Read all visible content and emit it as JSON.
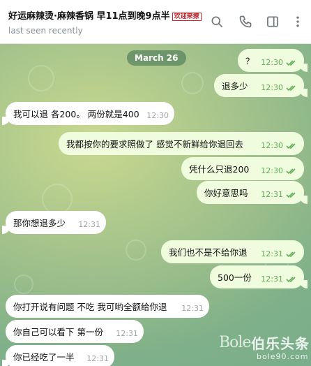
{
  "header": {
    "title": "好运麻辣烫·麻辣香锅 早11点到晚9点半",
    "title_badge": "欢迎来撩",
    "status": "last seen recently",
    "icons": [
      "search-icon",
      "phone-icon",
      "sidebar-toggle-icon",
      "more-vertical-icon"
    ]
  },
  "chat": {
    "date_label": "March 26",
    "messages": [
      {
        "dir": "out",
        "text": "？",
        "time": "12:30",
        "read": true
      },
      {
        "dir": "out",
        "text": "退多少",
        "time": "12:30",
        "read": true
      },
      {
        "dir": "in",
        "text": "我可以退 各200。 两份就是400",
        "time": "12:30"
      },
      {
        "dir": "out",
        "text": "我都按你的要求照做了 感觉不新鲜给你退回去",
        "time": "12:30",
        "read": true
      },
      {
        "dir": "out",
        "text": "凭什么只退200",
        "time": "12:30",
        "read": true
      },
      {
        "dir": "out",
        "text": "你好意思吗",
        "time": "12:31",
        "read": true
      },
      {
        "dir": "in",
        "text": "那你想退多少",
        "time": "12:31"
      },
      {
        "dir": "out",
        "text": "我们也不是不给你退",
        "time": "12:31",
        "read": true
      },
      {
        "dir": "out",
        "text": "500一份",
        "time": "12:31",
        "read": true
      },
      {
        "dir": "in",
        "text": "你打开说有问题 不吃 我可哟全额给你退",
        "time": "12:31"
      },
      {
        "dir": "in",
        "text": "你自己可以看下 第一份",
        "time": "12:31"
      },
      {
        "dir": "in",
        "text": "你已经吃了一半",
        "time": "12:31"
      }
    ]
  },
  "watermark": {
    "logo": "Bole",
    "name": "伯乐头条",
    "url": "bole90.com"
  },
  "colors": {
    "outgoing_bubble": "#effdde",
    "incoming_bubble": "#ffffff",
    "check_color": "#5fad56",
    "background_green": "#9fc08b"
  }
}
